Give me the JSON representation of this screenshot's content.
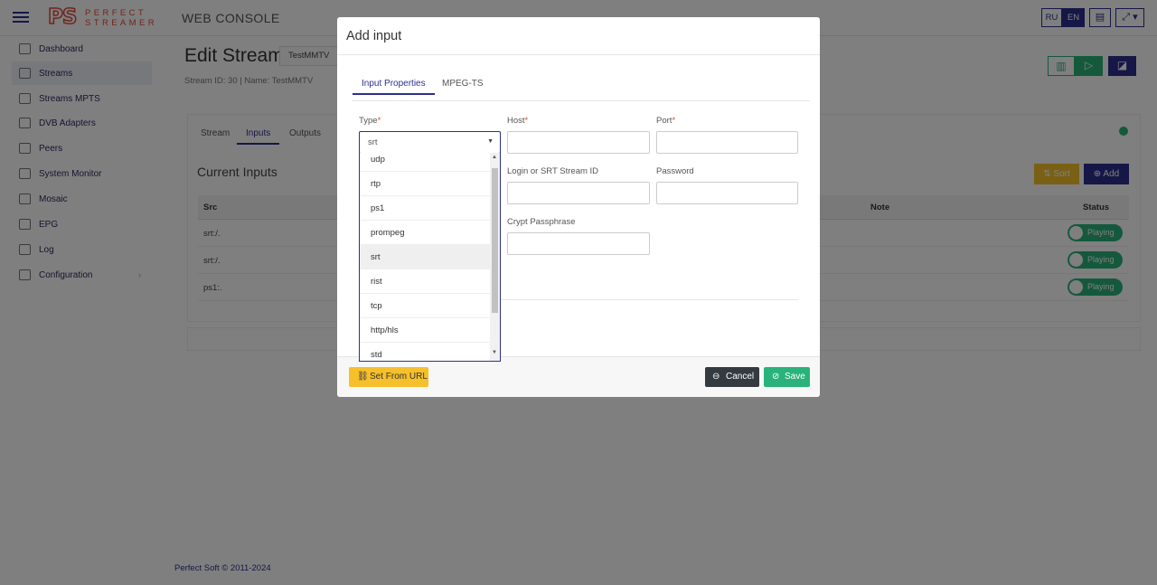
{
  "app": {
    "logo_mark": "PS",
    "logo_line1": "PERFECT",
    "logo_line2": "STREAMER",
    "title": "WEB CONSOLE"
  },
  "topbar": {
    "lang_ru": "RU",
    "lang_en": "EN",
    "icon1": "layout-icon",
    "icon2": "fullscreen-icon"
  },
  "sidebar": {
    "items": [
      {
        "label": "Dashboard",
        "icon": "dashboard-icon"
      },
      {
        "label": "Streams",
        "icon": "streams-icon",
        "active": true
      },
      {
        "label": "Streams MPTS",
        "icon": "streams-mpts-icon"
      },
      {
        "label": "DVB Adapters",
        "icon": "dvb-icon"
      },
      {
        "label": "Peers",
        "icon": "peers-icon"
      },
      {
        "label": "System Monitor",
        "icon": "monitor-icon"
      },
      {
        "label": "Mosaic",
        "icon": "mosaic-icon"
      },
      {
        "label": "EPG",
        "icon": "epg-icon"
      },
      {
        "label": "Log",
        "icon": "log-icon"
      },
      {
        "label": "Configuration",
        "icon": "gear-icon",
        "caret": "›"
      }
    ]
  },
  "footer": "Perfect Soft © 2011-2024",
  "page": {
    "title": "Edit Stream",
    "stream_name": "TestMMTV",
    "subtitle": "Stream ID: 30 | Name: TestMMTV",
    "tabs": [
      "Stream",
      "Inputs",
      "Outputs"
    ],
    "section_title": "Current Inputs",
    "sort_label": "Sort",
    "add_label": "Add",
    "columns": {
      "src": "Src",
      "note": "Note",
      "status": "Status"
    },
    "rows": [
      {
        "src": "srt:/.",
        "status": "Playing"
      },
      {
        "src": "srt:/.",
        "status": "Playing"
      },
      {
        "src": "ps1:.",
        "status": "Playing"
      }
    ]
  },
  "modal": {
    "title": "Add input",
    "tabs": [
      "Input Properties",
      "MPEG-TS"
    ],
    "fields": {
      "type_label": "Type",
      "type_value": "srt",
      "host_label": "Host",
      "port_label": "Port",
      "login_label": "Login or SRT Stream ID",
      "password_label": "Password",
      "passphrase_label": "Crypt Passphrase",
      "required_mark": "*"
    },
    "dropdown_options": [
      "udp",
      "rtp",
      "ps1",
      "prompeg",
      "srt",
      "rist",
      "tcp",
      "http/hls",
      "std"
    ],
    "highlighted_option": "srt",
    "buttons": {
      "set_from_url": "Set From URL",
      "cancel": "Cancel",
      "save": "Save"
    }
  },
  "colors": {
    "primary": "#2c2f8f",
    "success": "#2ab27b",
    "warning": "#f5c02b",
    "dark": "#343a40",
    "brand": "#e0493a"
  }
}
